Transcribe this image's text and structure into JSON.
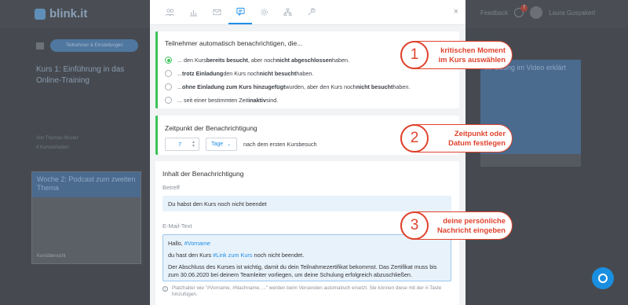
{
  "app": {
    "logo": "blink.it",
    "bg_user_name": "Laura Gusyakert",
    "bg_nav_label": "Feedback",
    "bg_badge_count": "7",
    "bg_pill_label": "Teilnehmer & Einstellungen",
    "bg_course_title": "Kurs 1: Einführung in das Online-Training",
    "bg_meta_line1": "Von Thomas Muster",
    "bg_meta_line2": "4 Kurseinheiten",
    "bg_card_title": "Woche 2: Podcast zum zweiten Thema",
    "bg_card_footer": "Kursübersicht",
    "bg_right_card_title": "...: Übung im Video erklärt"
  },
  "modal": {
    "tabs": [
      {
        "name": "participants",
        "icon": "users-icon"
      },
      {
        "name": "statistics",
        "icon": "bar-chart-icon"
      },
      {
        "name": "email",
        "icon": "mail-icon"
      },
      {
        "name": "notifications",
        "icon": "message-icon",
        "active": true
      },
      {
        "name": "settings",
        "icon": "gear-icon"
      },
      {
        "name": "structure",
        "icon": "hierarchy-icon"
      },
      {
        "name": "tools",
        "icon": "wrench-icon"
      }
    ],
    "close_label": "×",
    "section_recipients": {
      "title": "Teilnehmer automatisch benachrichtigen, die...",
      "options": [
        {
          "pre": "... den Kurs ",
          "b1": "bereits besucht",
          "mid": ", aber noch ",
          "b2": "nicht abgeschlossen",
          "post": " haben.",
          "checked": true
        },
        {
          "pre": "... ",
          "b1": "trotz Einladung",
          "mid": " den Kurs noch ",
          "b2": "nicht besucht",
          "post": " haben."
        },
        {
          "pre": "... ",
          "b1": "ohne Einladung zum Kurs hinzugefügt",
          "mid": " wurden, aber den Kurs noch ",
          "b2": "nicht besucht",
          "post": " haben."
        },
        {
          "pre": "... seit einer bestimmten Zeit ",
          "b1": "inaktiv",
          "mid": " sind.",
          "b2": "",
          "post": ""
        }
      ]
    },
    "section_timing": {
      "title": "Zeitpunkt der Benachrichtigung",
      "value": "7",
      "unit": "Tage",
      "after_text": "nach dem ersten Kursbesuch"
    },
    "section_content": {
      "title": "Inhalt der Benachrichtigung",
      "subject_label": "Betreff",
      "subject_value": "Du habst den Kurs noch nicht beendet",
      "email_label": "E-Mail-Text",
      "greeting": "Hallo, ",
      "greeting_tag": "#Vorname",
      "line2_pre": "du hast den Kurs ",
      "line2_tag": "#Link zum Kurs",
      "line2_post": " noch nicht beendet.",
      "line3": "Der Abschluss des Kurses ist wichtig, damit du dein Teilnahmezertifikat bekommst. Das Zertifikat muss bis zum 30.06.2020 bei deinem Teamleiter vorliegen, um deine Schulung erfolgreich abzuschließen.",
      "hint": "Platzhalter wie \"#Vorname, #Nachname, ...\" werden beim Versenden automatisch ersetzt. Sie können diese mit der #-Taste hinzufügen."
    }
  },
  "callouts": [
    {
      "number": "1",
      "text": "kritischen Moment im Kurs auswählen"
    },
    {
      "number": "2",
      "text": "Zeitpunkt oder Datum festlegen"
    },
    {
      "number": "3",
      "text": "deine persönliche Nachricht eingeben"
    }
  ],
  "colors": {
    "accent": "#1f8ee8",
    "success": "#3cc35a",
    "callout": "#e0432e"
  }
}
